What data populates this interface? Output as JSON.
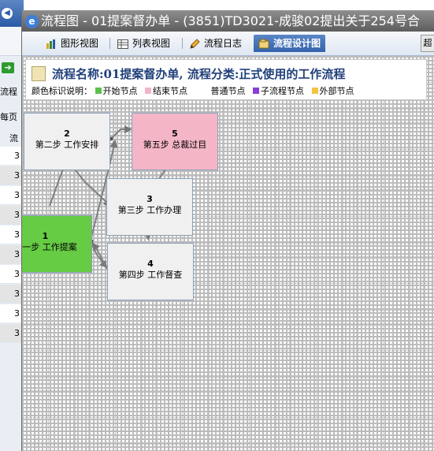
{
  "background_app": {
    "row_values": [
      "3",
      "3",
      "3",
      "3",
      "3",
      "3",
      "3",
      "3",
      "3",
      "3"
    ],
    "labels": {
      "flow": "流程",
      "per_page": "每页",
      "col": "流"
    }
  },
  "window": {
    "title": "流程图 - 01提案督办单 - (3851)TD3021-成骏02提出关于254号合",
    "tabs": [
      {
        "label": "图形视图",
        "icon": "graph-icon"
      },
      {
        "label": "列表视图",
        "icon": "list-icon"
      },
      {
        "label": "流程日志",
        "icon": "log-icon"
      },
      {
        "label": "流程设计图",
        "icon": "design-icon",
        "active": true
      }
    ],
    "right_button": "超"
  },
  "flow_info": {
    "name_line": "流程名称:01提案督办单, 流程分类:正式使用的工作流程",
    "legend_title": "颜色标识说明：",
    "legend": [
      {
        "label": "开始节点",
        "color": "#5cc04a"
      },
      {
        "label": "结束节点",
        "color": "#f4b6c6"
      },
      {
        "label": "普通节点",
        "color": "#ffffff"
      },
      {
        "label": "子流程节点",
        "color": "#8a3fd6"
      },
      {
        "label": "外部节点",
        "color": "#f5c242"
      }
    ]
  },
  "nodes": [
    {
      "num": "1",
      "label": "第一步 工作提案",
      "type": "start"
    },
    {
      "num": "2",
      "label": "第二步 工作安排",
      "type": "normal"
    },
    {
      "num": "3",
      "label": "第三步 工作办理",
      "type": "normal"
    },
    {
      "num": "4",
      "label": "第四步 工作督查",
      "type": "normal"
    },
    {
      "num": "5",
      "label": "第五步 总裁过目",
      "type": "end"
    }
  ]
}
